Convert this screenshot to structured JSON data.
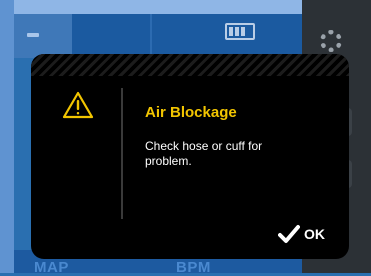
{
  "background": {
    "bottom_labels": [
      "MAP",
      "BPM"
    ]
  },
  "alert": {
    "title": "Air Blockage",
    "message": "Check hose or cuff for problem.",
    "ok_label": "OK",
    "icon": "warning-triangle-icon",
    "colors": {
      "title": "#f2c500",
      "dialog_bg": "#000000",
      "text": "#ffffff"
    }
  }
}
